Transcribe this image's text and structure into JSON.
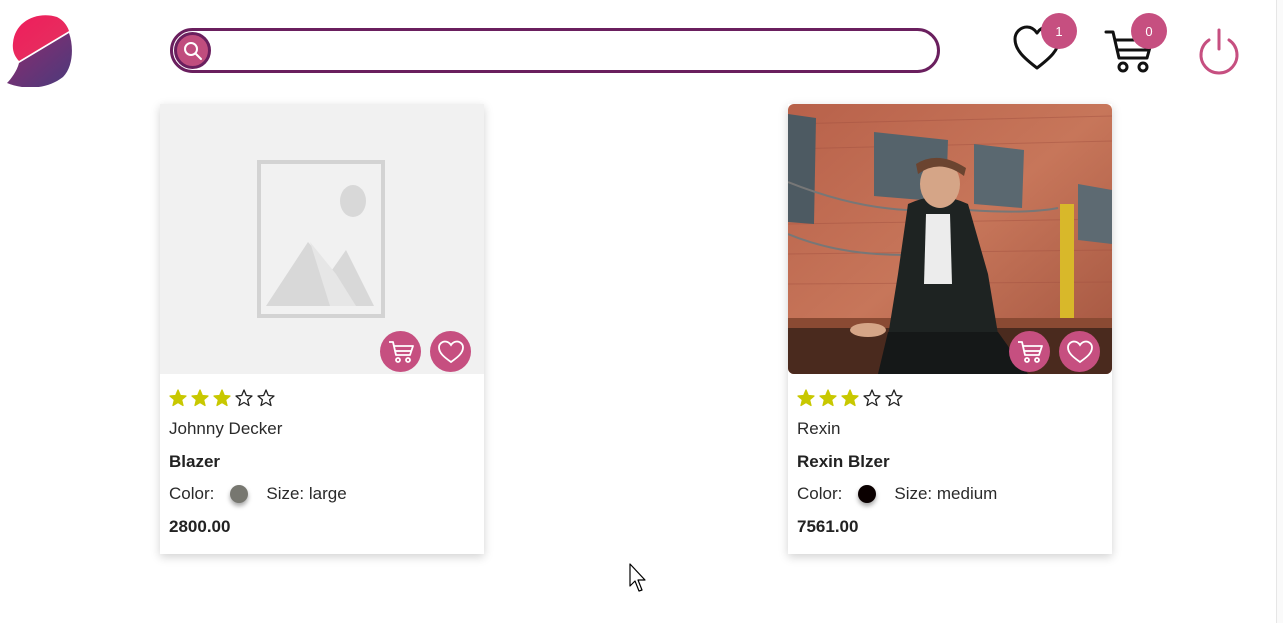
{
  "header": {
    "search": {
      "placeholder": "",
      "value": ""
    },
    "wishlist_count": "1",
    "cart_count": "0"
  },
  "colors": {
    "accent": "#c64f80",
    "border": "#6a1f5e",
    "star_on": "#c8c800"
  },
  "products": [
    {
      "brand": "Johnny Decker",
      "name": "Blazer",
      "color_label": "Color:",
      "color_value": "#777770",
      "size_label": "Size: large",
      "price": "2800.00",
      "rating": 3,
      "rating_max": 5,
      "image": "placeholder"
    },
    {
      "brand": "Rexin",
      "name": "Rexin Blzer",
      "color_label": "Color:",
      "color_value": "#0a0000",
      "size_label": "Size: medium",
      "price": "7561.00",
      "rating": 3,
      "rating_max": 5,
      "image": "photo"
    }
  ]
}
